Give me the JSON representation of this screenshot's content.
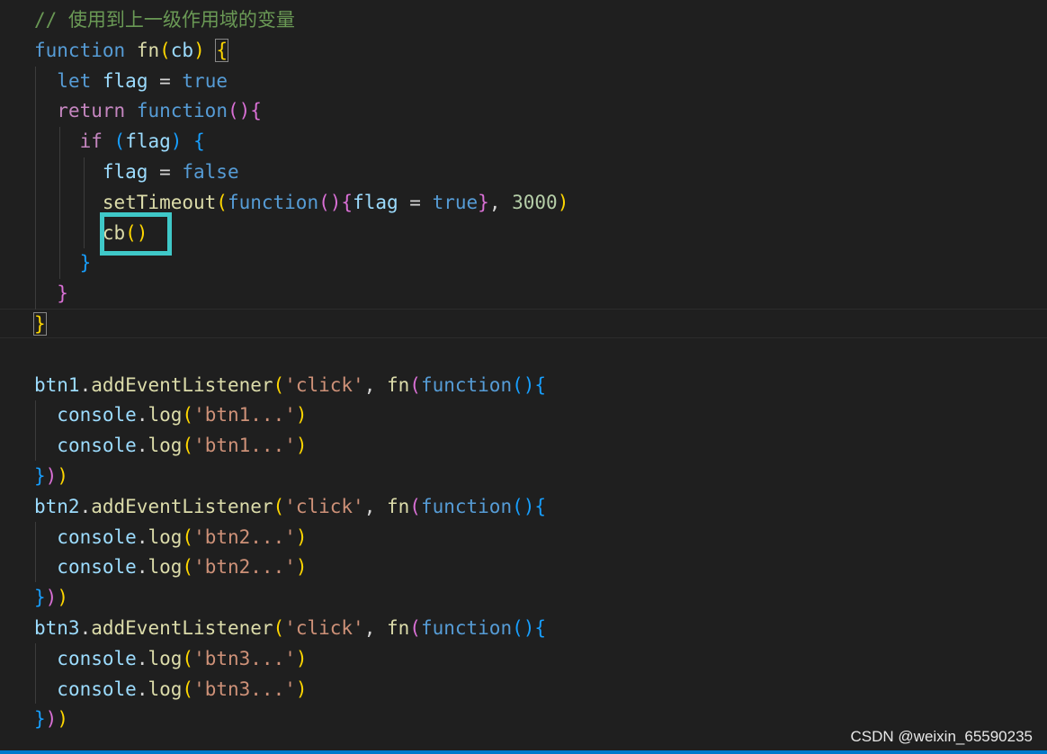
{
  "editor": {
    "lines": [
      [
        {
          "t": "// 使用到上一级作用域的变量",
          "c": "comment"
        }
      ],
      [
        {
          "t": "function",
          "c": "keyword"
        },
        {
          "t": " ",
          "c": "punct"
        },
        {
          "t": "fn",
          "c": "func"
        },
        {
          "t": "(",
          "c": "b1"
        },
        {
          "t": "cb",
          "c": "var"
        },
        {
          "t": ")",
          "c": "b1"
        },
        {
          "t": " ",
          "c": "punct"
        },
        {
          "t": "{",
          "c": "b1 match"
        }
      ],
      [
        {
          "t": "  ",
          "c": "punct"
        },
        {
          "t": "let",
          "c": "keyword"
        },
        {
          "t": " ",
          "c": "punct"
        },
        {
          "t": "flag",
          "c": "var"
        },
        {
          "t": " = ",
          "c": "punct"
        },
        {
          "t": "true",
          "c": "keyword"
        }
      ],
      [
        {
          "t": "  ",
          "c": "punct"
        },
        {
          "t": "return",
          "c": "control"
        },
        {
          "t": " ",
          "c": "punct"
        },
        {
          "t": "function",
          "c": "keyword"
        },
        {
          "t": "()",
          "c": "b2"
        },
        {
          "t": "{",
          "c": "b2"
        }
      ],
      [
        {
          "t": "    ",
          "c": "punct"
        },
        {
          "t": "if",
          "c": "control"
        },
        {
          "t": " ",
          "c": "punct"
        },
        {
          "t": "(",
          "c": "b3"
        },
        {
          "t": "flag",
          "c": "var"
        },
        {
          "t": ")",
          "c": "b3"
        },
        {
          "t": " ",
          "c": "punct"
        },
        {
          "t": "{",
          "c": "b3"
        }
      ],
      [
        {
          "t": "      ",
          "c": "punct"
        },
        {
          "t": "flag",
          "c": "var"
        },
        {
          "t": " = ",
          "c": "punct"
        },
        {
          "t": "false",
          "c": "keyword"
        }
      ],
      [
        {
          "t": "      ",
          "c": "punct"
        },
        {
          "t": "setTimeout",
          "c": "func"
        },
        {
          "t": "(",
          "c": "b1"
        },
        {
          "t": "function",
          "c": "keyword"
        },
        {
          "t": "()",
          "c": "b2"
        },
        {
          "t": "{",
          "c": "b2"
        },
        {
          "t": "flag",
          "c": "var"
        },
        {
          "t": " = ",
          "c": "punct"
        },
        {
          "t": "true",
          "c": "keyword"
        },
        {
          "t": "}",
          "c": "b2"
        },
        {
          "t": ", ",
          "c": "punct"
        },
        {
          "t": "3000",
          "c": "number"
        },
        {
          "t": ")",
          "c": "b1"
        }
      ],
      [
        {
          "t": "      ",
          "c": "punct"
        },
        {
          "t": "cb",
          "c": "func"
        },
        {
          "t": "()",
          "c": "b1"
        }
      ],
      [
        {
          "t": "    ",
          "c": "punct"
        },
        {
          "t": "}",
          "c": "b3"
        }
      ],
      [
        {
          "t": "  ",
          "c": "punct"
        },
        {
          "t": "}",
          "c": "b2"
        }
      ],
      [
        {
          "t": "}",
          "c": "b1 match"
        }
      ],
      [],
      [
        {
          "t": "btn1",
          "c": "var"
        },
        {
          "t": ".",
          "c": "punct"
        },
        {
          "t": "addEventListener",
          "c": "func"
        },
        {
          "t": "(",
          "c": "b1"
        },
        {
          "t": "'click'",
          "c": "string"
        },
        {
          "t": ", ",
          "c": "punct"
        },
        {
          "t": "fn",
          "c": "func"
        },
        {
          "t": "(",
          "c": "b2"
        },
        {
          "t": "function",
          "c": "keyword"
        },
        {
          "t": "()",
          "c": "b3"
        },
        {
          "t": "{",
          "c": "b3"
        }
      ],
      [
        {
          "t": "  ",
          "c": "punct"
        },
        {
          "t": "console",
          "c": "var"
        },
        {
          "t": ".",
          "c": "punct"
        },
        {
          "t": "log",
          "c": "func"
        },
        {
          "t": "(",
          "c": "b1"
        },
        {
          "t": "'btn1...'",
          "c": "string"
        },
        {
          "t": ")",
          "c": "b1"
        }
      ],
      [
        {
          "t": "  ",
          "c": "punct"
        },
        {
          "t": "console",
          "c": "var"
        },
        {
          "t": ".",
          "c": "punct"
        },
        {
          "t": "log",
          "c": "func"
        },
        {
          "t": "(",
          "c": "b1"
        },
        {
          "t": "'btn1...'",
          "c": "string"
        },
        {
          "t": ")",
          "c": "b1"
        }
      ],
      [
        {
          "t": "}",
          "c": "b3"
        },
        {
          "t": ")",
          "c": "b2"
        },
        {
          "t": ")",
          "c": "b1"
        }
      ],
      [
        {
          "t": "btn2",
          "c": "var"
        },
        {
          "t": ".",
          "c": "punct"
        },
        {
          "t": "addEventListener",
          "c": "func"
        },
        {
          "t": "(",
          "c": "b1"
        },
        {
          "t": "'click'",
          "c": "string"
        },
        {
          "t": ", ",
          "c": "punct"
        },
        {
          "t": "fn",
          "c": "func"
        },
        {
          "t": "(",
          "c": "b2"
        },
        {
          "t": "function",
          "c": "keyword"
        },
        {
          "t": "()",
          "c": "b3"
        },
        {
          "t": "{",
          "c": "b3"
        }
      ],
      [
        {
          "t": "  ",
          "c": "punct"
        },
        {
          "t": "console",
          "c": "var"
        },
        {
          "t": ".",
          "c": "punct"
        },
        {
          "t": "log",
          "c": "func"
        },
        {
          "t": "(",
          "c": "b1"
        },
        {
          "t": "'btn2...'",
          "c": "string"
        },
        {
          "t": ")",
          "c": "b1"
        }
      ],
      [
        {
          "t": "  ",
          "c": "punct"
        },
        {
          "t": "console",
          "c": "var"
        },
        {
          "t": ".",
          "c": "punct"
        },
        {
          "t": "log",
          "c": "func"
        },
        {
          "t": "(",
          "c": "b1"
        },
        {
          "t": "'btn2...'",
          "c": "string"
        },
        {
          "t": ")",
          "c": "b1"
        }
      ],
      [
        {
          "t": "}",
          "c": "b3"
        },
        {
          "t": ")",
          "c": "b2"
        },
        {
          "t": ")",
          "c": "b1"
        }
      ],
      [
        {
          "t": "btn3",
          "c": "var"
        },
        {
          "t": ".",
          "c": "punct"
        },
        {
          "t": "addEventListener",
          "c": "func"
        },
        {
          "t": "(",
          "c": "b1"
        },
        {
          "t": "'click'",
          "c": "string"
        },
        {
          "t": ", ",
          "c": "punct"
        },
        {
          "t": "fn",
          "c": "func"
        },
        {
          "t": "(",
          "c": "b2"
        },
        {
          "t": "function",
          "c": "keyword"
        },
        {
          "t": "()",
          "c": "b3"
        },
        {
          "t": "{",
          "c": "b3"
        }
      ],
      [
        {
          "t": "  ",
          "c": "punct"
        },
        {
          "t": "console",
          "c": "var"
        },
        {
          "t": ".",
          "c": "punct"
        },
        {
          "t": "log",
          "c": "func"
        },
        {
          "t": "(",
          "c": "b1"
        },
        {
          "t": "'btn3...'",
          "c": "string"
        },
        {
          "t": ")",
          "c": "b1"
        }
      ],
      [
        {
          "t": "  ",
          "c": "punct"
        },
        {
          "t": "console",
          "c": "var"
        },
        {
          "t": ".",
          "c": "punct"
        },
        {
          "t": "log",
          "c": "func"
        },
        {
          "t": "(",
          "c": "b1"
        },
        {
          "t": "'btn3...'",
          "c": "string"
        },
        {
          "t": ")",
          "c": "b1"
        }
      ],
      [
        {
          "t": "}",
          "c": "b3"
        },
        {
          "t": ")",
          "c": "b2"
        },
        {
          "t": ")",
          "c": "b1"
        }
      ]
    ],
    "highlighted_code": "cb()",
    "theme": {
      "background": "#1f1f1f",
      "highlight_box": "#3fc8c8",
      "status_bar": "#007acc"
    }
  },
  "watermark": "CSDN @weixin_65590235"
}
